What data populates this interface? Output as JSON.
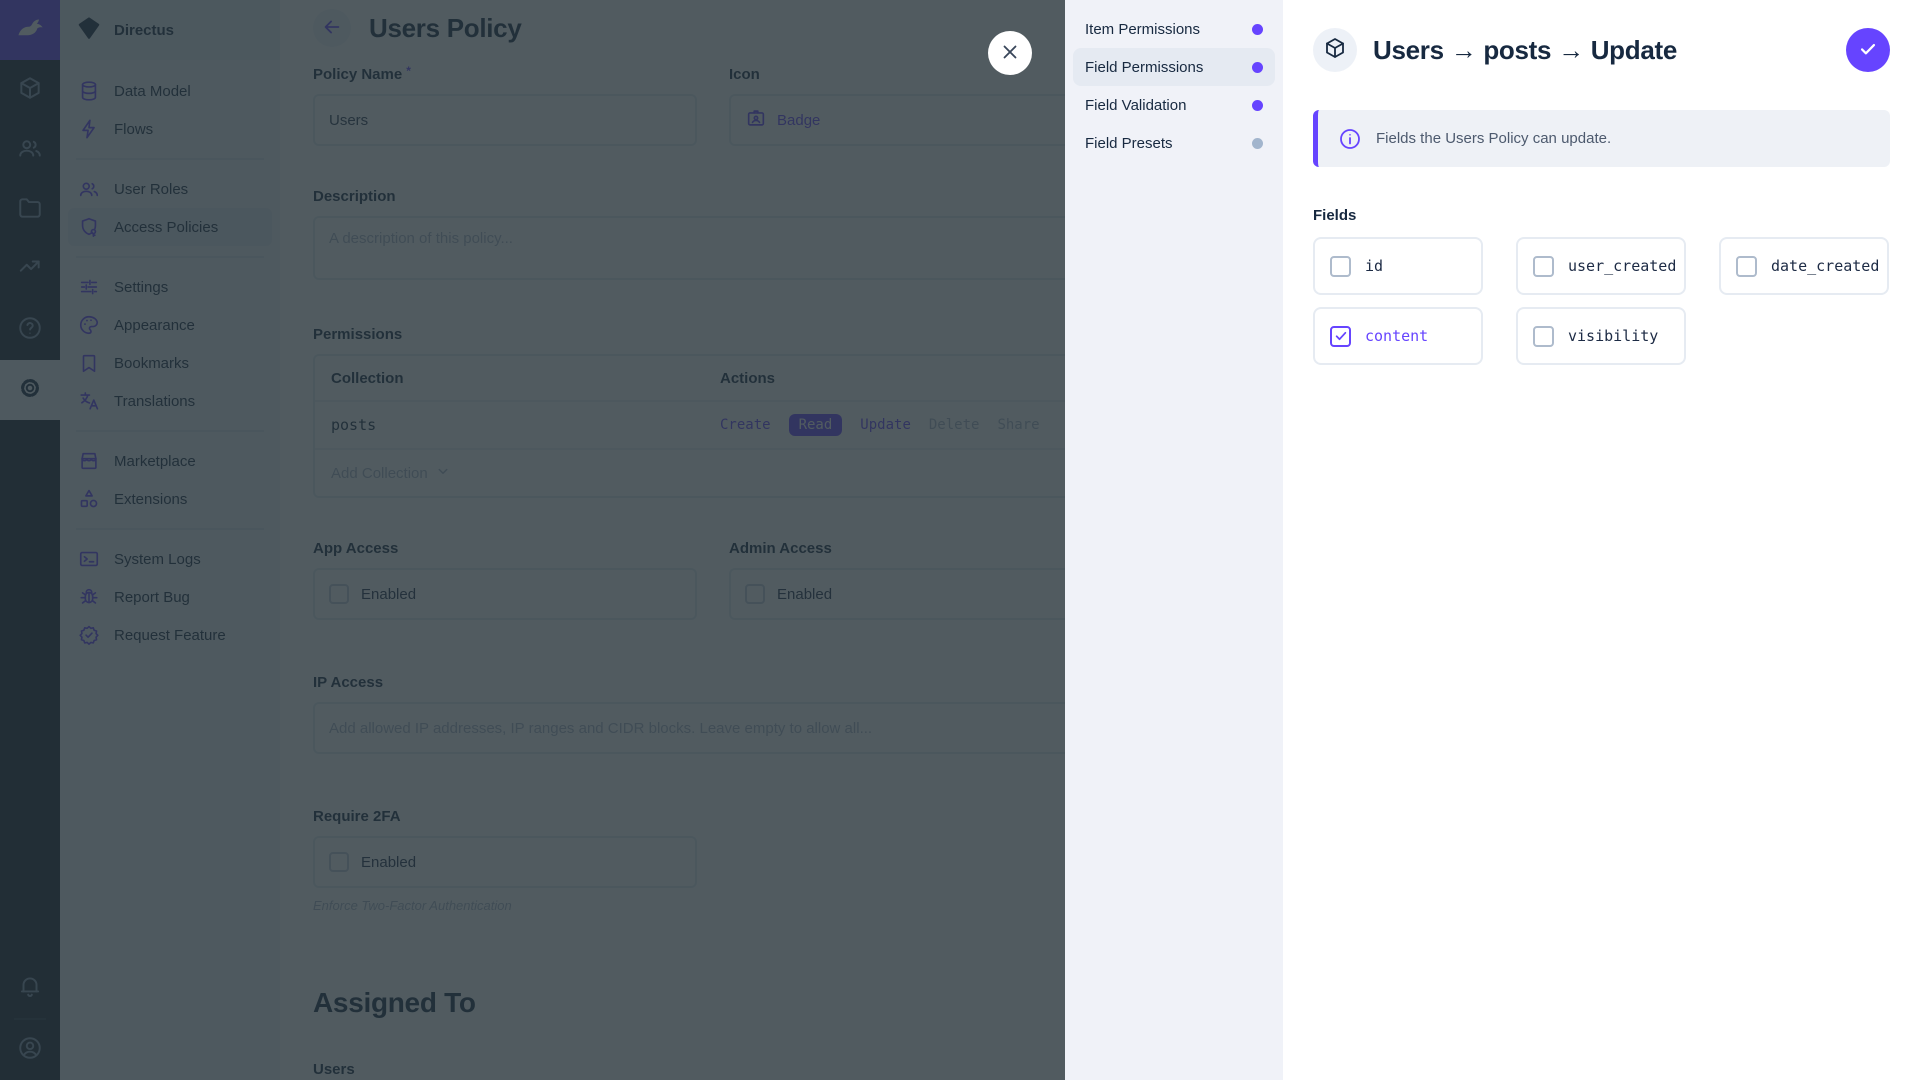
{
  "colors": {
    "accent": "#6644ff",
    "muted_dot": "#a2b5cd",
    "active_dot": "#6644ff"
  },
  "module_bar": {
    "logo_icon": "directus-rabbit-icon",
    "modules": [
      {
        "name": "content",
        "icon": "box",
        "active": false
      },
      {
        "name": "users",
        "icon": "people",
        "active": false
      },
      {
        "name": "files",
        "icon": "folder",
        "active": false
      },
      {
        "name": "insights",
        "icon": "chart",
        "active": false
      },
      {
        "name": "docs",
        "icon": "help",
        "active": false
      },
      {
        "name": "settings",
        "icon": "gear",
        "active": true
      }
    ],
    "bottom": [
      {
        "name": "notifications",
        "icon": "bell"
      },
      {
        "name": "account",
        "icon": "avatar"
      }
    ]
  },
  "sidebar": {
    "project_name": "Directus",
    "groups": [
      {
        "items": [
          {
            "label": "Data Model",
            "icon": "database",
            "active": false
          },
          {
            "label": "Flows",
            "icon": "bolt",
            "active": false
          }
        ]
      },
      {
        "items": [
          {
            "label": "User Roles",
            "icon": "people",
            "active": false
          },
          {
            "label": "Access Policies",
            "icon": "shield",
            "active": true
          }
        ]
      },
      {
        "items": [
          {
            "label": "Settings",
            "icon": "tune",
            "active": false
          },
          {
            "label": "Appearance",
            "icon": "palette",
            "active": false
          },
          {
            "label": "Bookmarks",
            "icon": "bookmark",
            "active": false
          },
          {
            "label": "Translations",
            "icon": "translate",
            "active": false
          }
        ]
      },
      {
        "items": [
          {
            "label": "Marketplace",
            "icon": "storefront",
            "active": false
          },
          {
            "label": "Extensions",
            "icon": "extensions",
            "active": false
          }
        ]
      },
      {
        "items": [
          {
            "label": "System Logs",
            "icon": "terminal",
            "active": false
          },
          {
            "label": "Report Bug",
            "icon": "bug",
            "active": false
          },
          {
            "label": "Request Feature",
            "icon": "feature",
            "active": false
          }
        ]
      }
    ]
  },
  "main": {
    "title": "Users Policy",
    "fields": {
      "policy_name_label": "Policy Name",
      "required_mark": "*",
      "policy_name_value": "Users",
      "icon_label": "Icon",
      "icon_value": "Badge",
      "description_label": "Description",
      "description_placeholder": "A description of this policy...",
      "permissions_label": "Permissions",
      "collection_header": "Collection",
      "actions_header": "Actions",
      "collection_row": "posts",
      "actions": [
        {
          "label": "Create",
          "state": "on"
        },
        {
          "label": "Read",
          "state": "selected"
        },
        {
          "label": "Update",
          "state": "on"
        },
        {
          "label": "Delete",
          "state": "off"
        },
        {
          "label": "Share",
          "state": "off"
        }
      ],
      "add_collection": "Add Collection",
      "app_access_label": "App Access",
      "admin_access_label": "Admin Access",
      "enabled_label": "Enabled",
      "ip_access_label": "IP Access",
      "ip_access_placeholder": "Add allowed IP addresses, IP ranges and CIDR blocks. Leave empty to allow all...",
      "require_2fa_label": "Require 2FA",
      "require_2fa_note": "Enforce Two-Factor Authentication",
      "assigned_to_title": "Assigned To",
      "users_label": "Users"
    }
  },
  "drawer": {
    "nav": [
      {
        "label": "Item Permissions",
        "dot": "#6644ff",
        "active": false
      },
      {
        "label": "Field Permissions",
        "dot": "#6644ff",
        "active": true
      },
      {
        "label": "Field Validation",
        "dot": "#6644ff",
        "active": false
      },
      {
        "label": "Field Presets",
        "dot": "#a2b5cd",
        "active": false
      }
    ],
    "title": "Users → posts → Update",
    "notice": "Fields the Users Policy can update.",
    "fields_label": "Fields",
    "fields": [
      {
        "name": "id",
        "checked": false
      },
      {
        "name": "user_created",
        "checked": false
      },
      {
        "name": "date_created",
        "checked": false
      },
      {
        "name": "content",
        "checked": true
      },
      {
        "name": "visibility",
        "checked": false
      }
    ]
  }
}
